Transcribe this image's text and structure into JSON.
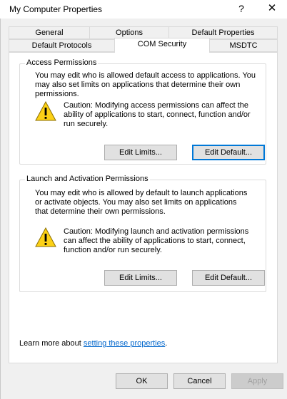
{
  "window": {
    "title": "My Computer Properties",
    "help_glyph": "?",
    "close_glyph": "✕"
  },
  "tabs": {
    "row_back": [
      "General",
      "Options",
      "Default Properties"
    ],
    "row_front": [
      "Default Protocols",
      "COM Security",
      "MSDTC"
    ],
    "active": "COM Security"
  },
  "access": {
    "legend": "Access Permissions",
    "description": "You may edit who is allowed default access to applications. You may also set limits on applications that determine their own permissions.",
    "caution": "Caution: Modifying access permissions can affect the ability of applications to start, connect, function and/or run securely.",
    "edit_limits": "Edit Limits...",
    "edit_default": "Edit Default..."
  },
  "launch": {
    "legend": "Launch and Activation Permissions",
    "description": "You may edit who is allowed by default to launch applications or activate objects. You may also set limits on applications that determine their own permissions.",
    "caution": "Caution: Modifying launch and activation permissions can affect the ability of applications to start, connect, function and/or run securely.",
    "edit_limits": "Edit Limits...",
    "edit_default": "Edit Default..."
  },
  "learn": {
    "prefix": "Learn more about ",
    "link": "setting these properties",
    "suffix": "."
  },
  "footer": {
    "ok": "OK",
    "cancel": "Cancel",
    "apply": "Apply"
  },
  "colors": {
    "warning_fill": "#fcd116",
    "link": "#0066cc",
    "focus_border": "#0078d7"
  },
  "icons": {
    "warning": "warning-icon"
  }
}
